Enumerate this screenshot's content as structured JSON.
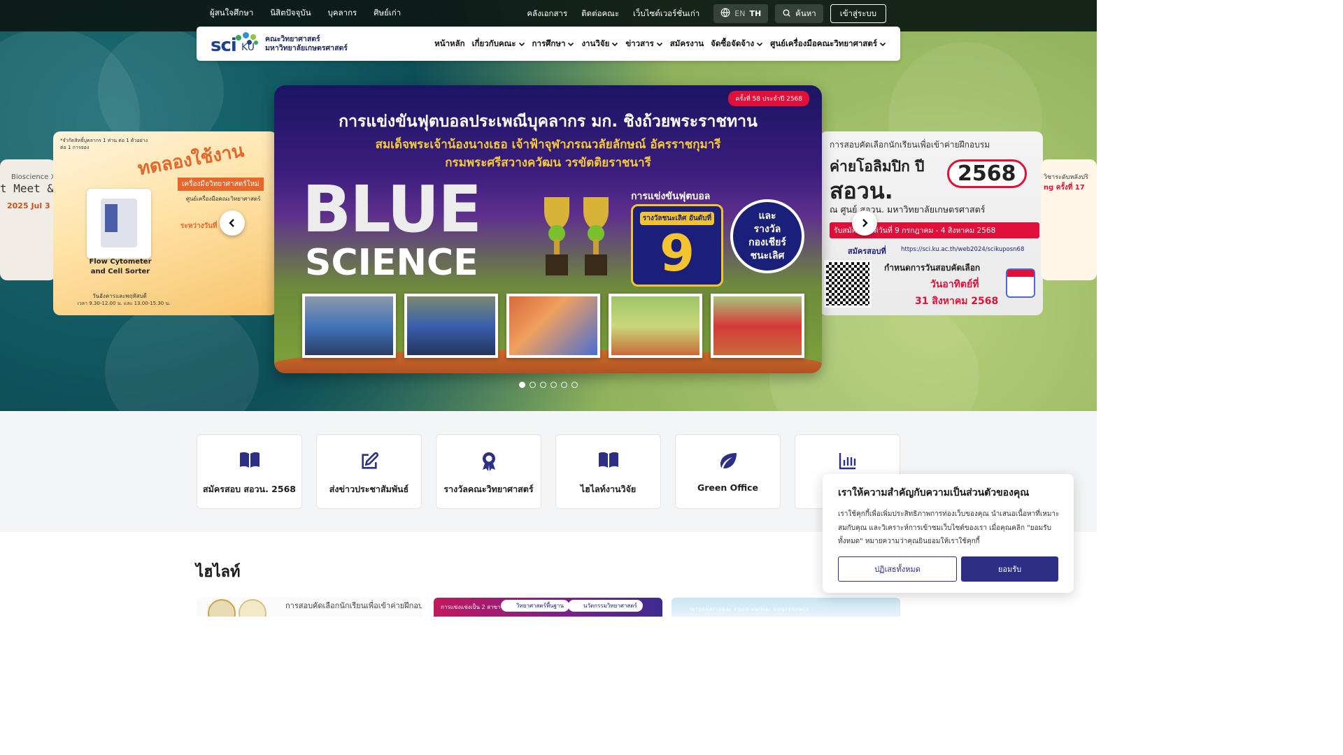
{
  "topbar": {
    "left_links": [
      "ผู้สนใจศึกษา",
      "นิสิตปัจจุบัน",
      "บุคลากร",
      "ศิษย์เก่า"
    ],
    "right_links": [
      "คลังเอกสาร",
      "ติดต่อคณะ",
      "เว็บไซต์เวอร์ชั่นเก่า"
    ],
    "lang_en": "EN",
    "lang_th": "TH",
    "search_label": "ค้นหา",
    "login_label": "เข้าสู่ระบบ"
  },
  "logo": {
    "mark_sci": "sci",
    "mark_ku": "KU",
    "line1": "คณะวิทยาศาสตร์",
    "line2": "มหาวิทยาลัยเกษตรศาสตร์"
  },
  "nav": {
    "items": [
      {
        "label": "หน้าหลัก",
        "dropdown": false
      },
      {
        "label": "เกี่ยวกับคณะ",
        "dropdown": true
      },
      {
        "label": "การศึกษา",
        "dropdown": true
      },
      {
        "label": "งานวิจัย",
        "dropdown": true
      },
      {
        "label": "ข่าวสาร",
        "dropdown": true
      },
      {
        "label": "สมัครงาน",
        "dropdown": false
      },
      {
        "label": "จัดซื้อจัดจ้าง",
        "dropdown": true
      },
      {
        "label": "ศูนย์เครื่องมือคณะวิทยาศาสตร์",
        "dropdown": true
      }
    ]
  },
  "carousel": {
    "main": {
      "badge": "ครั้งที่ 58 ประจำปี 2568",
      "title": "การแข่งขันฟุตบอลประเพณีบุคลากร มก. ชิงถ้วยพระราชทาน",
      "sub1": "สมเด็จพระเจ้าน้องนางเธอ เจ้าฟ้าจุฬาภรณวลัยลักษณ์ อัครราชกุมารี",
      "sub2": "กรมพระศรีสวางควัฒน วรขัตติยราชนารี",
      "word1": "BLUE",
      "word2": "SCIENCE",
      "award_heading": "การแข่งขันฟุตบอล",
      "award_label": "รางวัลชนะเลิศ อันดับที่",
      "award_number": "9",
      "cheer_lines": [
        "และ",
        "รางวัล",
        "กองเชียร์",
        "ชนะเลิศ"
      ]
    },
    "left": {
      "note": "*จำกัดสิทธิ์บุคลากร 1 ท่าน ต่อ 1 ตัวอย่าง ต่อ 1 การจอง",
      "headline": "ทดลองใช้งาน",
      "subhead": "เครื่องมือวิทยาศาสตร์ใหม่",
      "center": "ศูนย์เครื่องมือคณะวิทยาศาสตร์",
      "device": "Flow Cytometer and Cell Sorter",
      "period": "ระหว่างวันที่",
      "times": "วันอังคารและพฤหัสบดี",
      "time_range": "เวลา 9.30-12.00 น. และ 13.00-15.30 น."
    },
    "far_left": {
      "line1": "Bioscience X",
      "line2": "t Meet &",
      "line3": "2025 Jul 3"
    },
    "right": {
      "heading": "การสอบคัดเลือกนักเรียนเพื่อเข้าค่ายฝึกอบรม",
      "camp": "ค่ายโอลิมปิก ปี",
      "year": "2568",
      "org": "สอวน.",
      "venue": "ณ ศูนย์ สอวน. มหาวิทยาลัยเกษตรศาสตร์",
      "apply": "รับสมัครตั้งแต่วันที่ 9 กรกฎาคม - 4 สิงหาคม 2568",
      "url_label": "สมัครสอบที่",
      "url": "https://sci.ku.ac.th/web2024/scikuposn68",
      "exam_label": "กำหนดการวันสอบคัดเลือก",
      "exam_day": "วันอาทิตย์ที่",
      "exam_date": "31 สิงหาคม 2568"
    },
    "far_right": {
      "line1": "วิชาระดับหลังปริ",
      "line2": "ng ครั้งที่ 17"
    },
    "slides_total": 6,
    "active_index": 0
  },
  "quick_links": [
    {
      "label": "สมัครสอบ สอวน. 2568",
      "icon": "book-open-icon"
    },
    {
      "label": "ส่งข่าวประชาสัมพันธ์",
      "icon": "edit-icon"
    },
    {
      "label": "รางวัลคณะวิทยาศาสตร์",
      "icon": "award-icon"
    },
    {
      "label": "ไฮไลท์งานวิจัย",
      "icon": "book-open-icon"
    },
    {
      "label": "Green Office",
      "icon": "leaf-icon"
    },
    {
      "label": "",
      "icon": "bar-chart-icon"
    }
  ],
  "highlight": {
    "title": "ไฮไลท์",
    "card1_text": "การสอบคัดเลือกนักเรียนเพื่อเข้าค่ายฝึกอบรม",
    "card2_text": "การแข่งแข่งเป็น 2 สาขา",
    "card2_tag1": "วิทยาศาสตร์พื้นฐาน",
    "card2_tag2": "นวัตกรรมวิทยาศาสตร์",
    "card3_text": "INTERNATIONAL FOOD ANIMAL CONFERENCE"
  },
  "cookie": {
    "title": "เราให้ความสำคัญกับความเป็นส่วนตัวของคุณ",
    "body": "เราใช้คุกกี้เพื่อเพิ่มประสิทธิภาพการท่องเว็บของคุณ นำเสนอเนื้อหาที่เหมาะสมกับคุณ และวิเคราะห์การเข้าชมเว็บไซต์ของเรา เมื่อคุณคลิก \"ยอมรับทั้งหมด\" หมายความว่าคุณยินยอมให้เราใช้คุกกี้",
    "reject_label": "ปฏิเสธทั้งหมด",
    "accept_label": "ยอมรับ"
  },
  "colors": {
    "brand": "#2c2f85",
    "topbar": "#0c1814",
    "accent_red": "#e0103a",
    "gold": "#f3c430"
  }
}
